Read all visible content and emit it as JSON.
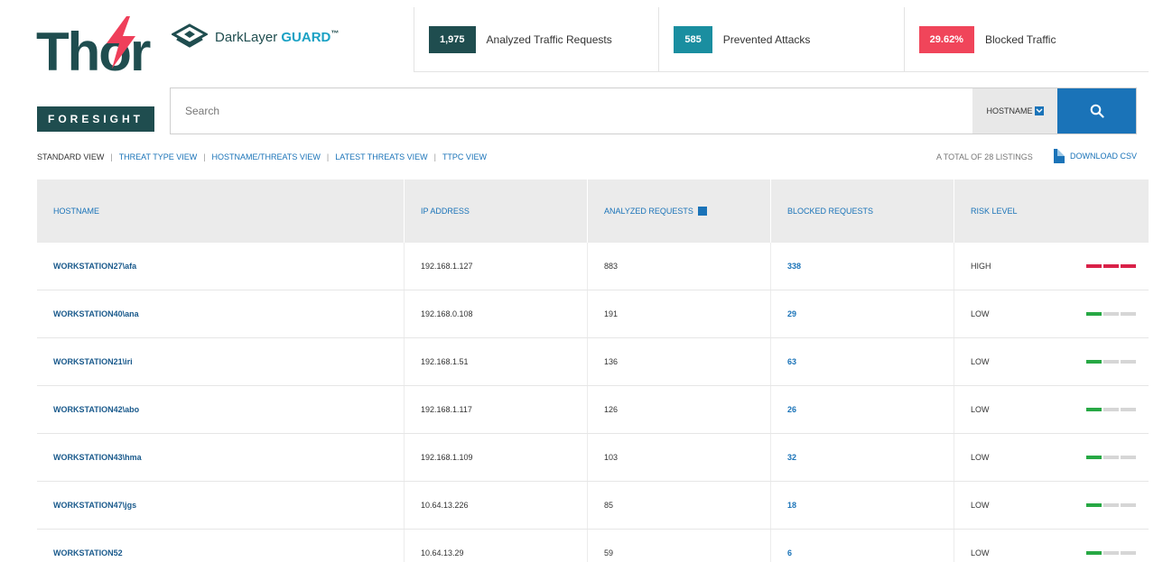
{
  "brand": {
    "thor": "Thor",
    "darklayer": "DarkLayer",
    "guard": "GUARD",
    "tm": "™",
    "foresight": "FORESIGHT"
  },
  "stats": [
    {
      "value": "1,975",
      "label": "Analyzed Traffic Requests",
      "color": "#1f4d4f"
    },
    {
      "value": "585",
      "label": "Prevented Attacks",
      "color": "#1a8ea0"
    },
    {
      "value": "29.62%",
      "label": "Blocked Traffic",
      "color": "#f0455a"
    }
  ],
  "search": {
    "placeholder": "Search",
    "filter": "HOSTNAME"
  },
  "views": {
    "tabs": [
      "STANDARD VIEW",
      "THREAT TYPE VIEW",
      "HOSTNAME/THREATS VIEW",
      "LATEST THREATS VIEW",
      "TTPC VIEW"
    ],
    "active": 0,
    "total_listings": "A TOTAL OF 28 LISTINGS",
    "download": "DOWNLOAD CSV"
  },
  "table": {
    "headers": [
      "HOSTNAME",
      "IP ADDRESS",
      "ANALYZED REQUESTS",
      "BLOCKED REQUESTS",
      "RISK LEVEL"
    ],
    "rows": [
      {
        "hostname": "WORKSTATION27\\afa",
        "ip": "192.168.1.127",
        "analyzed": "883",
        "blocked": "338",
        "risk": "HIGH",
        "level": 3
      },
      {
        "hostname": "WORKSTATION40\\ana",
        "ip": "192.168.0.108",
        "analyzed": "191",
        "blocked": "29",
        "risk": "LOW",
        "level": 1
      },
      {
        "hostname": "WORKSTATION21\\iri",
        "ip": "192.168.1.51",
        "analyzed": "136",
        "blocked": "63",
        "risk": "LOW",
        "level": 1
      },
      {
        "hostname": "WORKSTATION42\\abo",
        "ip": "192.168.1.117",
        "analyzed": "126",
        "blocked": "26",
        "risk": "LOW",
        "level": 1
      },
      {
        "hostname": "WORKSTATION43\\hma",
        "ip": "192.168.1.109",
        "analyzed": "103",
        "blocked": "32",
        "risk": "LOW",
        "level": 1
      },
      {
        "hostname": "WORKSTATION47\\jgs",
        "ip": "10.64.13.226",
        "analyzed": "85",
        "blocked": "18",
        "risk": "LOW",
        "level": 1
      },
      {
        "hostname": "WORKSTATION52",
        "ip": "10.64.13.29",
        "analyzed": "59",
        "blocked": "6",
        "risk": "LOW",
        "level": 1
      }
    ]
  }
}
